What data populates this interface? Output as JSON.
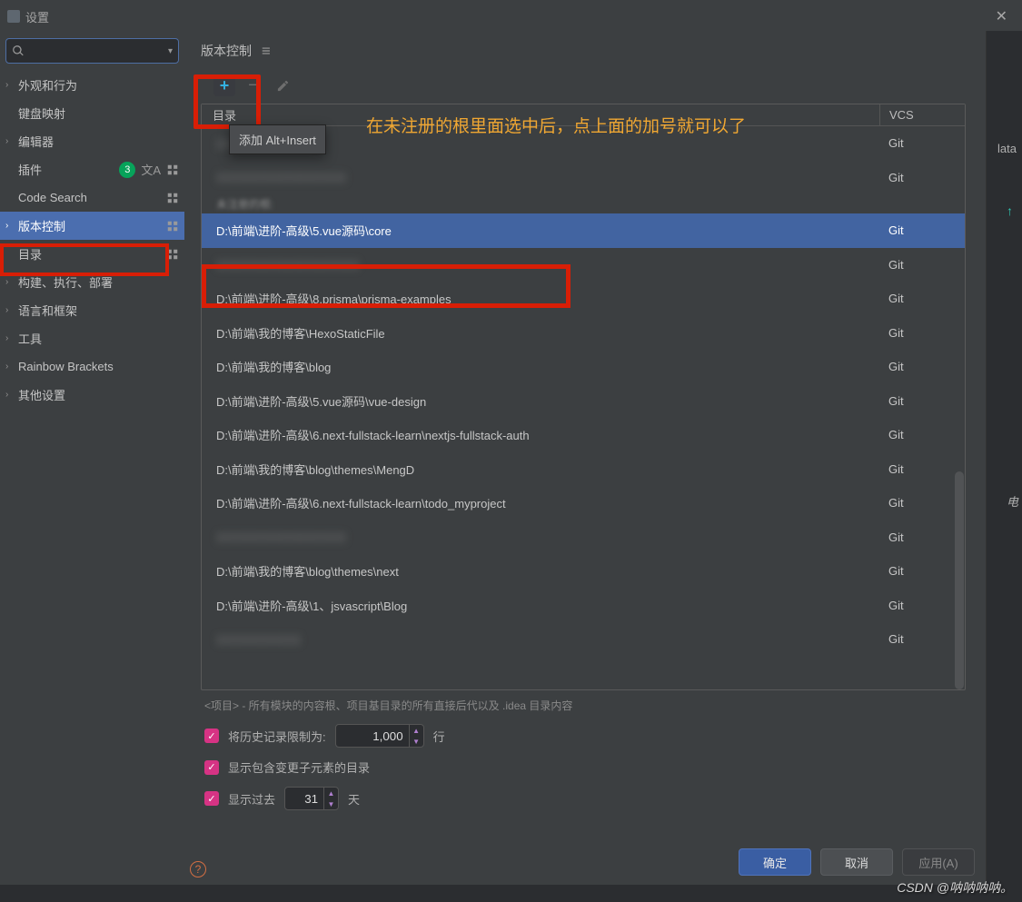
{
  "title": "设置",
  "search": {
    "placeholder": "Q▾"
  },
  "sidebar": {
    "items": [
      {
        "label": "外观和行为",
        "expandable": true
      },
      {
        "label": "键盘映射",
        "expandable": false
      },
      {
        "label": "编辑器",
        "expandable": true
      },
      {
        "label": "插件",
        "expandable": false,
        "badge": "3",
        "icons": true
      },
      {
        "label": "Code Search",
        "expandable": false,
        "sep": true
      },
      {
        "label": "版本控制",
        "expandable": true,
        "selected": true,
        "sep": true
      },
      {
        "label": "目录",
        "expandable": false,
        "sep": true
      },
      {
        "label": "构建、执行、部署",
        "expandable": true
      },
      {
        "label": "语言和框架",
        "expandable": true
      },
      {
        "label": "工具",
        "expandable": true
      },
      {
        "label": "Rainbow Brackets",
        "expandable": true
      },
      {
        "label": "其他设置",
        "expandable": true
      }
    ]
  },
  "crumb": {
    "label": "版本控制"
  },
  "tooltip": "添加  Alt+Insert",
  "annotation": "在未注册的根里面选中后，点上面的加号就可以了",
  "table": {
    "header_dir": "目录",
    "header_vcs": "VCS",
    "unreg_label": "未注册的根:",
    "rows_top": [
      {
        "dir": "▯▯▯▯▯▯▯▯▯▯▯▯▯▯▯",
        "vcs": "Git",
        "blur": true
      },
      {
        "dir": "▯▯▯▯▯▯▯▯▯▯▯▯▯▯▯▯▯▯▯▯",
        "vcs": "Git",
        "blur": true
      }
    ],
    "selected_row": {
      "dir": "D:\\前端\\进阶-高级\\5.vue源码\\core",
      "vcs": "Git"
    },
    "rows": [
      {
        "dir": "▯▯▯▯▯▯▯▯▯▯▯▯▯▯▯▯▯▯▯▯▯▯",
        "vcs": "Git",
        "blur": true
      },
      {
        "dir": "D:\\前端\\进阶-高级\\8.prisma\\prisma-examples",
        "vcs": "Git"
      },
      {
        "dir": "D:\\前端\\我的博客\\HexoStaticFile",
        "vcs": "Git"
      },
      {
        "dir": "D:\\前端\\我的博客\\blog",
        "vcs": "Git"
      },
      {
        "dir": "D:\\前端\\进阶-高级\\5.vue源码\\vue-design",
        "vcs": "Git"
      },
      {
        "dir": "D:\\前端\\进阶-高级\\6.next-fullstack-learn\\nextjs-fullstack-auth",
        "vcs": "Git"
      },
      {
        "dir": "D:\\前端\\我的博客\\blog\\themes\\MengD",
        "vcs": "Git"
      },
      {
        "dir": "D:\\前端\\进阶-高级\\6.next-fullstack-learn\\todo_myproject",
        "vcs": "Git"
      },
      {
        "dir": "▯▯▯▯▯▯▯▯▯▯▯▯▯▯▯▯▯▯▯▯",
        "vcs": "Git",
        "blur": true
      },
      {
        "dir": "D:\\前端\\我的博客\\blog\\themes\\next",
        "vcs": "Git"
      },
      {
        "dir": "D:\\前端\\进阶-高级\\1、jsvascript\\Blog",
        "vcs": "Git"
      },
      {
        "dir": "▯▯▯▯▯▯▯▯▯▯▯▯▯",
        "vcs": "Git",
        "blur": true
      }
    ]
  },
  "meta_text": "<项目> - 所有模块的内容根、项目基目录的所有直接后代以及 .idea 目录内容",
  "form": {
    "limit_label": "将历史记录限制为:",
    "limit_value": "1,000",
    "limit_unit": "行",
    "show_label": "显示包含变更子元素的目录",
    "days_label": "显示过去",
    "days_value": "31",
    "days_unit": "天"
  },
  "buttons": {
    "ok": "确定",
    "cancel": "取消",
    "apply": "应用(A)"
  },
  "side": {
    "text1": "lata",
    "text2": "电"
  },
  "watermark": "CSDN @呐呐呐呐。"
}
